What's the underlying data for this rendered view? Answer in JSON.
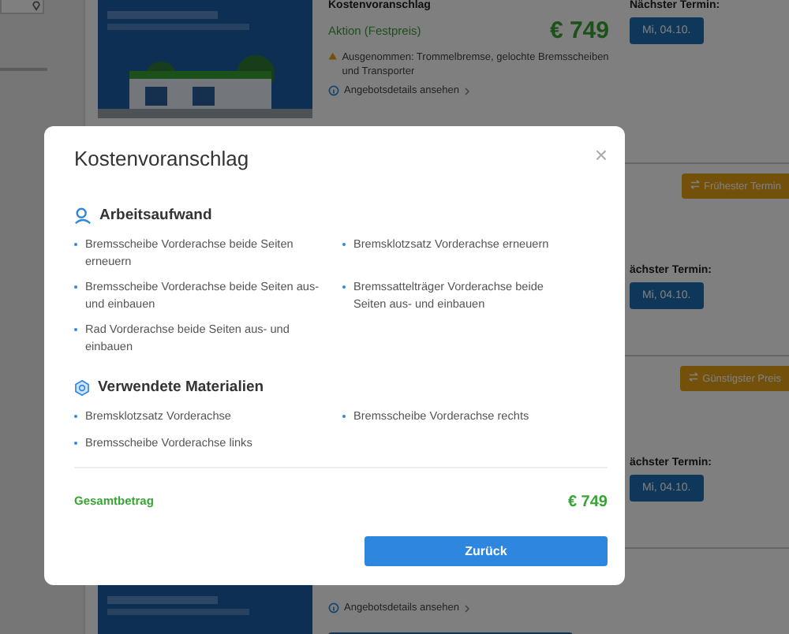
{
  "offers": [
    {
      "picture": true,
      "title": "Kostenvoranschlag",
      "offer_label": "Aktion (Festpreis)",
      "price": "€ 749",
      "note": "Ausgenommen: Trommelbremse, gelochte Bremsscheiben und Transporter",
      "details_link": "Angebotsdetails ansehen",
      "next_label": "Nächster Termin:",
      "date_button": "Mi, 04.10."
    },
    {
      "badge": "Frühester Termin",
      "next_label": "ächster Termin:",
      "date_button": "Mi, 04.10."
    },
    {
      "badge": "Günstigster Preis",
      "next_label": "ächster Termin:",
      "date_button": "Mi, 04.10."
    },
    {
      "picture": true,
      "details_link": "Angebotsdetails ansehen",
      "book_bar": true
    }
  ],
  "modal": {
    "title": "Kostenvoranschlag",
    "close": "×",
    "sections": [
      {
        "kind": "labor",
        "title": "Arbeitsaufwand",
        "items": [
          "Bremsscheibe Vorderachse beide Seiten erneuern",
          "Bremsklotzsatz Vorderachse erneuern",
          "Bremsscheibe Vorderachse beide Seiten aus- und einbauen",
          "Bremssattelträger Vorderachse beide Seiten aus- und einbauen",
          "Rad Vorderachse beide Seiten aus- und einbauen"
        ]
      },
      {
        "kind": "materials",
        "title": "Verwendete Materialien",
        "items": [
          "Bremsklotzsatz Vorderachse",
          "Bremsscheibe Vorderachse rechts",
          "Bremsscheibe Vorderachse links"
        ]
      }
    ],
    "total_label": "Gesamtbetrag",
    "total_value": "€ 749",
    "button": "Zurück"
  }
}
